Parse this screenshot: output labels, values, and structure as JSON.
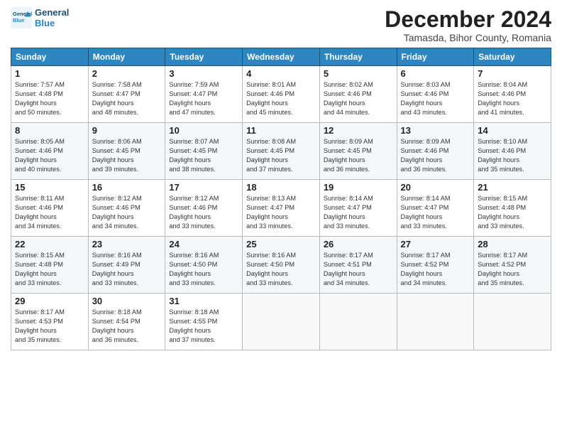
{
  "header": {
    "logo_line1": "General",
    "logo_line2": "Blue",
    "month_title": "December 2024",
    "subtitle": "Tamasda, Bihor County, Romania"
  },
  "weekdays": [
    "Sunday",
    "Monday",
    "Tuesday",
    "Wednesday",
    "Thursday",
    "Friday",
    "Saturday"
  ],
  "weeks": [
    [
      {
        "day": "1",
        "sunrise": "7:57 AM",
        "sunset": "4:48 PM",
        "daylight": "8 hours and 50 minutes."
      },
      {
        "day": "2",
        "sunrise": "7:58 AM",
        "sunset": "4:47 PM",
        "daylight": "8 hours and 48 minutes."
      },
      {
        "day": "3",
        "sunrise": "7:59 AM",
        "sunset": "4:47 PM",
        "daylight": "8 hours and 47 minutes."
      },
      {
        "day": "4",
        "sunrise": "8:01 AM",
        "sunset": "4:46 PM",
        "daylight": "8 hours and 45 minutes."
      },
      {
        "day": "5",
        "sunrise": "8:02 AM",
        "sunset": "4:46 PM",
        "daylight": "8 hours and 44 minutes."
      },
      {
        "day": "6",
        "sunrise": "8:03 AM",
        "sunset": "4:46 PM",
        "daylight": "8 hours and 43 minutes."
      },
      {
        "day": "7",
        "sunrise": "8:04 AM",
        "sunset": "4:46 PM",
        "daylight": "8 hours and 41 minutes."
      }
    ],
    [
      {
        "day": "8",
        "sunrise": "8:05 AM",
        "sunset": "4:46 PM",
        "daylight": "8 hours and 40 minutes."
      },
      {
        "day": "9",
        "sunrise": "8:06 AM",
        "sunset": "4:45 PM",
        "daylight": "8 hours and 39 minutes."
      },
      {
        "day": "10",
        "sunrise": "8:07 AM",
        "sunset": "4:45 PM",
        "daylight": "8 hours and 38 minutes."
      },
      {
        "day": "11",
        "sunrise": "8:08 AM",
        "sunset": "4:45 PM",
        "daylight": "8 hours and 37 minutes."
      },
      {
        "day": "12",
        "sunrise": "8:09 AM",
        "sunset": "4:45 PM",
        "daylight": "8 hours and 36 minutes."
      },
      {
        "day": "13",
        "sunrise": "8:09 AM",
        "sunset": "4:46 PM",
        "daylight": "8 hours and 36 minutes."
      },
      {
        "day": "14",
        "sunrise": "8:10 AM",
        "sunset": "4:46 PM",
        "daylight": "8 hours and 35 minutes."
      }
    ],
    [
      {
        "day": "15",
        "sunrise": "8:11 AM",
        "sunset": "4:46 PM",
        "daylight": "8 hours and 34 minutes."
      },
      {
        "day": "16",
        "sunrise": "8:12 AM",
        "sunset": "4:46 PM",
        "daylight": "8 hours and 34 minutes."
      },
      {
        "day": "17",
        "sunrise": "8:12 AM",
        "sunset": "4:46 PM",
        "daylight": "8 hours and 33 minutes."
      },
      {
        "day": "18",
        "sunrise": "8:13 AM",
        "sunset": "4:47 PM",
        "daylight": "8 hours and 33 minutes."
      },
      {
        "day": "19",
        "sunrise": "8:14 AM",
        "sunset": "4:47 PM",
        "daylight": "8 hours and 33 minutes."
      },
      {
        "day": "20",
        "sunrise": "8:14 AM",
        "sunset": "4:47 PM",
        "daylight": "8 hours and 33 minutes."
      },
      {
        "day": "21",
        "sunrise": "8:15 AM",
        "sunset": "4:48 PM",
        "daylight": "8 hours and 33 minutes."
      }
    ],
    [
      {
        "day": "22",
        "sunrise": "8:15 AM",
        "sunset": "4:48 PM",
        "daylight": "8 hours and 33 minutes."
      },
      {
        "day": "23",
        "sunrise": "8:16 AM",
        "sunset": "4:49 PM",
        "daylight": "8 hours and 33 minutes."
      },
      {
        "day": "24",
        "sunrise": "8:16 AM",
        "sunset": "4:50 PM",
        "daylight": "8 hours and 33 minutes."
      },
      {
        "day": "25",
        "sunrise": "8:16 AM",
        "sunset": "4:50 PM",
        "daylight": "8 hours and 33 minutes."
      },
      {
        "day": "26",
        "sunrise": "8:17 AM",
        "sunset": "4:51 PM",
        "daylight": "8 hours and 34 minutes."
      },
      {
        "day": "27",
        "sunrise": "8:17 AM",
        "sunset": "4:52 PM",
        "daylight": "8 hours and 34 minutes."
      },
      {
        "day": "28",
        "sunrise": "8:17 AM",
        "sunset": "4:52 PM",
        "daylight": "8 hours and 35 minutes."
      }
    ],
    [
      {
        "day": "29",
        "sunrise": "8:17 AM",
        "sunset": "4:53 PM",
        "daylight": "8 hours and 35 minutes."
      },
      {
        "day": "30",
        "sunrise": "8:18 AM",
        "sunset": "4:54 PM",
        "daylight": "8 hours and 36 minutes."
      },
      {
        "day": "31",
        "sunrise": "8:18 AM",
        "sunset": "4:55 PM",
        "daylight": "8 hours and 37 minutes."
      },
      null,
      null,
      null,
      null
    ]
  ]
}
